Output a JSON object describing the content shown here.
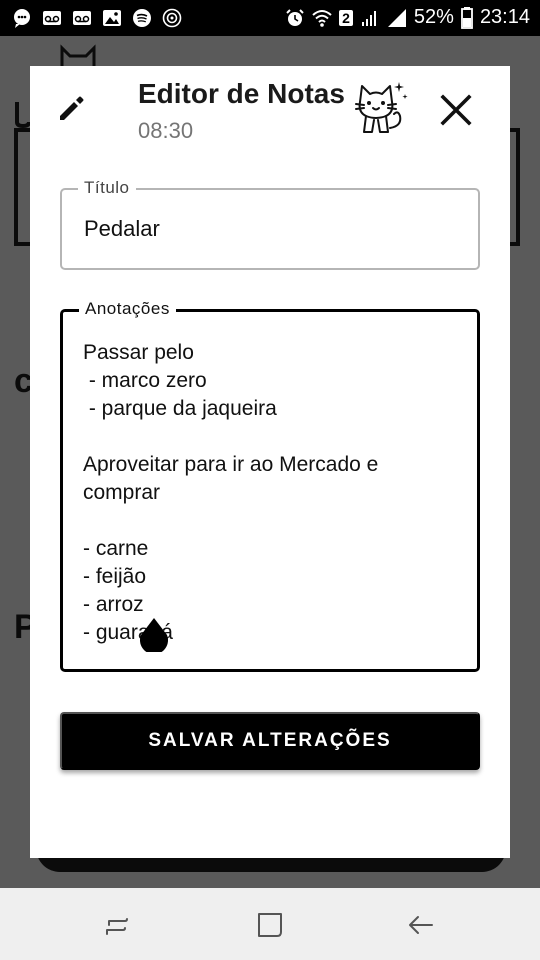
{
  "status_bar": {
    "notification_icons": [
      "chat-icon",
      "voicemail-icon",
      "voicemail-icon",
      "image-icon",
      "spotify-icon",
      "target-icon"
    ],
    "wifi_badge": "2",
    "battery": "52%",
    "time": "23:14"
  },
  "dialog": {
    "title": "Editor de Notas",
    "time": "08:30",
    "title_field": {
      "label": "Título",
      "value": "Pedalar"
    },
    "notes_field": {
      "label": "Anotações",
      "value": "Passar pelo\n - marco zero\n - parque da jaqueira\n\nAproveitar para ir ao Mercado e\ncomprar\n\n- carne\n- feijão\n- arroz\n- guaraná"
    },
    "save_label": "SALVAR ALTERAÇÕES"
  },
  "nav_bar": {
    "buttons": [
      "recent-apps-icon",
      "home-icon",
      "back-icon"
    ]
  }
}
